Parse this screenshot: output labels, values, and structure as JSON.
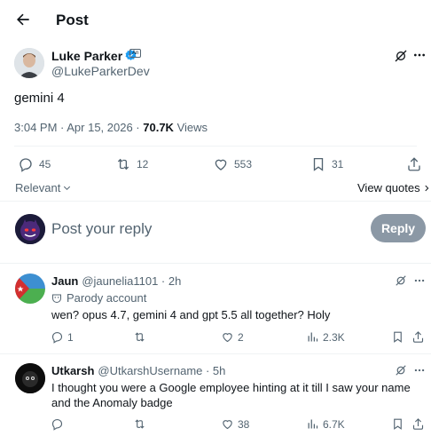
{
  "header": {
    "title": "Post"
  },
  "post": {
    "author_name": "Luke Parker",
    "affiliate_badge": "An",
    "author_handle": "@LukeParkerDev",
    "text": "gemini 4",
    "timestamp": "3:04 PM · Apr 15, 2026 · ",
    "views_count": "70.7K",
    "views_label": " Views",
    "stats": {
      "replies": "45",
      "reposts": "12",
      "likes": "553",
      "bookmarks": "31"
    }
  },
  "filters": {
    "sort_label": "Relevant",
    "view_quotes": "View quotes"
  },
  "composer": {
    "placeholder": "Post your reply",
    "reply_button": "Reply"
  },
  "replies": [
    {
      "name": "Jaun",
      "handle": "@jaunelia1101 · 2h",
      "badge_text": "Parody account",
      "text": "wen? opus 4.7, gemini 4 and gpt 5.5 all together? Holy",
      "stats": {
        "replies": "1",
        "reposts": "",
        "likes": "2",
        "views": "2.3K"
      }
    },
    {
      "name": "Utkarsh",
      "handle": "@UtkarshUsername · 5h",
      "text": "I thought you were a Google employee hinting at it till I saw your name and the Anomaly badge",
      "stats": {
        "replies": "",
        "reposts": "",
        "likes": "38",
        "views": "6.7K"
      }
    }
  ],
  "colors": {
    "verified": "#1d9bf0",
    "text": "#0f1419",
    "muted": "#536471",
    "reply_btn": "#8b98a5"
  }
}
